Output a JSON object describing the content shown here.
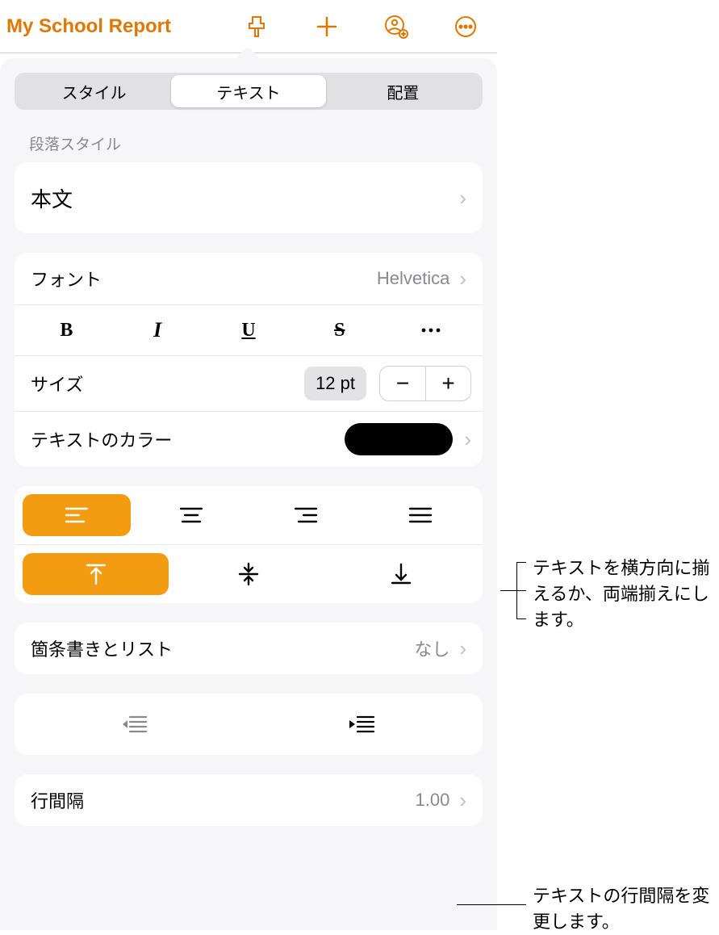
{
  "toolbar": {
    "title": "My School Report"
  },
  "tabs": {
    "style": "スタイル",
    "text": "テキスト",
    "arrange": "配置"
  },
  "paragraph": {
    "label": "段落スタイル",
    "value": "本文"
  },
  "font": {
    "label": "フォント",
    "value": "Helvetica"
  },
  "size": {
    "label": "サイズ",
    "value": "12 pt"
  },
  "textColor": {
    "label": "テキストのカラー"
  },
  "bullets": {
    "label": "箇条書きとリスト",
    "value": "なし"
  },
  "lineSpacing": {
    "label": "行間隔",
    "value": "1.00"
  },
  "callouts": {
    "align": "テキストを横方向に揃えるか、両端揃えにします。",
    "spacing": "テキストの行間隔を変更します。"
  }
}
